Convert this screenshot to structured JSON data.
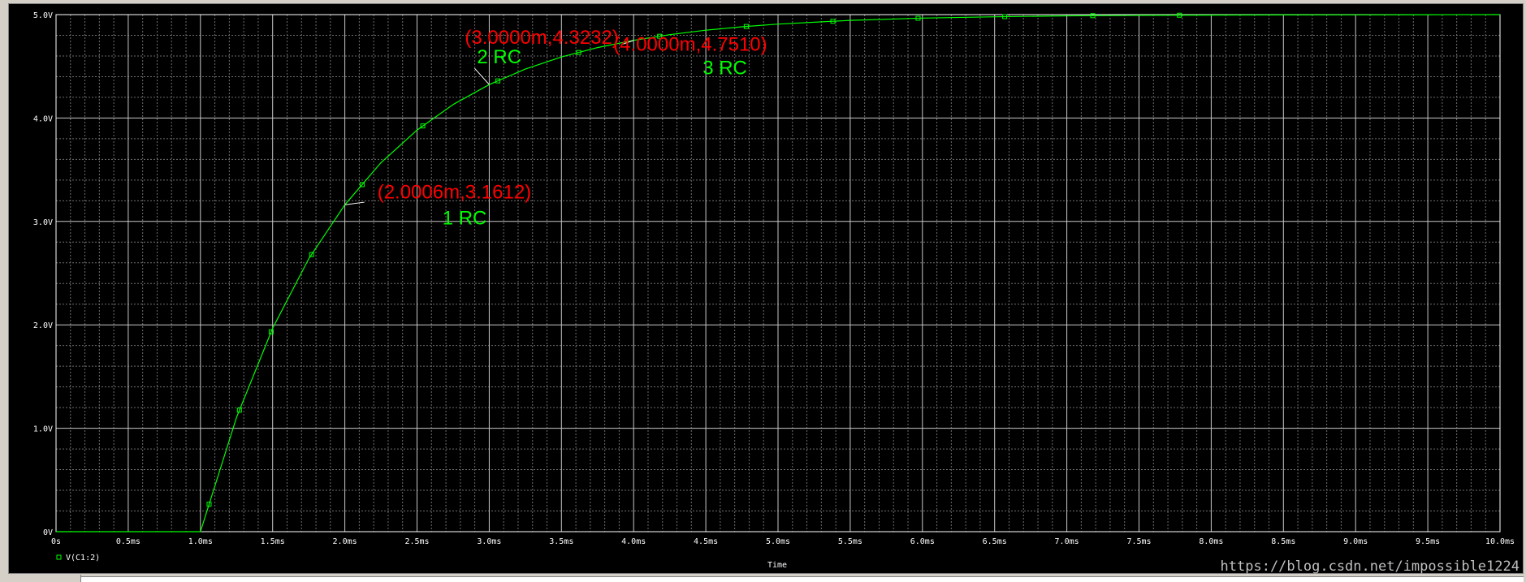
{
  "watermark": "https://blog.csdn.net/impossible1224",
  "chart_data": {
    "type": "line",
    "xlabel": "Time",
    "ylabel": "",
    "xlim": [
      0,
      10.0
    ],
    "ylim": [
      0,
      5.0
    ],
    "x_ticks": [
      "0s",
      "0.5ms",
      "1.0ms",
      "1.5ms",
      "2.0ms",
      "2.5ms",
      "3.0ms",
      "3.5ms",
      "4.0ms",
      "4.5ms",
      "5.0ms",
      "5.5ms",
      "6.0ms",
      "6.5ms",
      "7.0ms",
      "7.5ms",
      "8.0ms",
      "8.5ms",
      "9.0ms",
      "9.5ms",
      "10.0ms"
    ],
    "y_ticks": [
      "0V",
      "1.0V",
      "2.0V",
      "3.0V",
      "4.0V",
      "5.0V"
    ],
    "grid": true,
    "legend_position": "bottom-left",
    "background": "#000000",
    "grid_color": "#c8c8c8",
    "axis_color": "#ffffff",
    "label_color": "#ffffff",
    "series": [
      {
        "name": "V(C1:2)",
        "color": "#00ff00",
        "marker": "square",
        "x": [
          0,
          1.0,
          1.25,
          1.5,
          1.75,
          2.0,
          2.25,
          2.5,
          2.75,
          3.0,
          3.25,
          3.5,
          3.75,
          4.0,
          4.25,
          4.5,
          4.75,
          5.0,
          5.5,
          6.0,
          6.5,
          7.0,
          7.5,
          8.0,
          8.5,
          9.0,
          9.5,
          10.0
        ],
        "y": [
          0,
          0,
          1.106,
          1.967,
          2.638,
          3.161,
          3.568,
          3.884,
          4.131,
          4.323,
          4.473,
          4.59,
          4.681,
          4.751,
          4.806,
          4.849,
          4.882,
          4.908,
          4.944,
          4.966,
          4.979,
          4.988,
          4.993,
          4.995,
          4.997,
          4.998,
          4.999,
          5.0
        ],
        "marker_x": [
          1.06,
          1.27,
          1.49,
          1.77,
          2.12,
          2.54,
          3.06,
          3.62,
          4.18,
          4.78,
          5.38,
          5.97,
          6.57,
          7.18,
          7.78
        ]
      }
    ],
    "annotations": [
      {
        "coord_text": "(2.0006m,3.1612)",
        "label": "1 RC",
        "x": 2.0006,
        "y": 3.1612,
        "coord_color": "#ff0000",
        "label_color": "#00ff00"
      },
      {
        "coord_text": "(3.0000m,4.3232)",
        "label": "2 RC",
        "x": 3.0,
        "y": 4.3232,
        "coord_color": "#ff0000",
        "label_color": "#00ff00"
      },
      {
        "coord_text": "(4.0000m,4.7510)",
        "label": "3 RC",
        "x": 4.0,
        "y": 4.751,
        "coord_color": "#ff0000",
        "label_color": "#00ff00"
      }
    ]
  }
}
